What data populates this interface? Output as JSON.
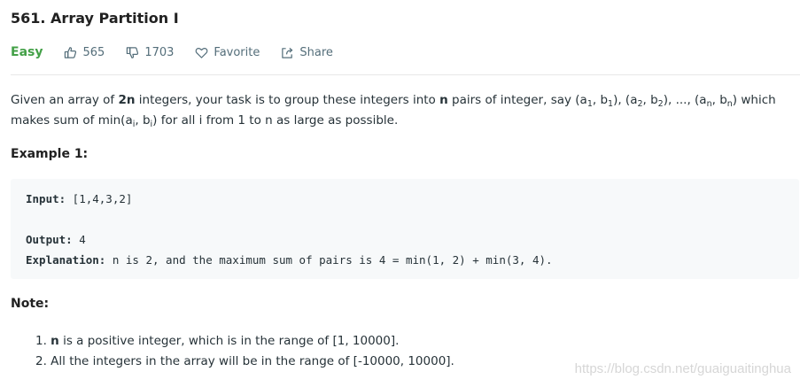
{
  "problem": {
    "title": "561. Array Partition I",
    "difficulty": "Easy",
    "likes": "565",
    "dislikes": "1703",
    "favorite_label": "Favorite",
    "share_label": "Share",
    "colors": {
      "easy": "#43a047",
      "meta": "#546e7a",
      "code_bg": "#f7f9fa"
    }
  },
  "description": {
    "p1": "Given an array of ",
    "bold_2n": "2n",
    "p2": " integers, your task is to group these integers into ",
    "bold_n": "n",
    "p3": " pairs of integer, say (a",
    "s1": "1",
    "p4": ", b",
    "s2": "1",
    "p5": "), (a",
    "s3": "2",
    "p6": ", b",
    "s4": "2",
    "p7": "), ..., (a",
    "s5": "n",
    "p8": ", b",
    "s6": "n",
    "p9": ") which makes sum of min(a",
    "s7": "i",
    "p10": ", b",
    "s8": "i",
    "p11": ") for all i from 1 to n as large as possible."
  },
  "example": {
    "heading": "Example 1:",
    "input_label": "Input:",
    "input_value": " [1,4,3,2]",
    "output_label": "Output:",
    "output_value": " 4",
    "explanation_label": "Explanation:",
    "explanation_value": " n is 2, and the maximum sum of pairs is 4 = min(1, 2) + min(3, 4)."
  },
  "note": {
    "heading": "Note:",
    "item1_num": "1. ",
    "item1_bold": "n",
    "item1_text": " is a positive integer, which is in the range of [1, 10000].",
    "item2_num": "2. ",
    "item2_text": "All the integers in the array will be in the range of [-10000, 10000]."
  },
  "watermark": "https://blog.csdn.net/guaiguaitinghua",
  "icons": {
    "like": "thumbs-up-icon",
    "dislike": "thumbs-down-icon",
    "favorite": "heart-icon",
    "share": "share-icon"
  }
}
